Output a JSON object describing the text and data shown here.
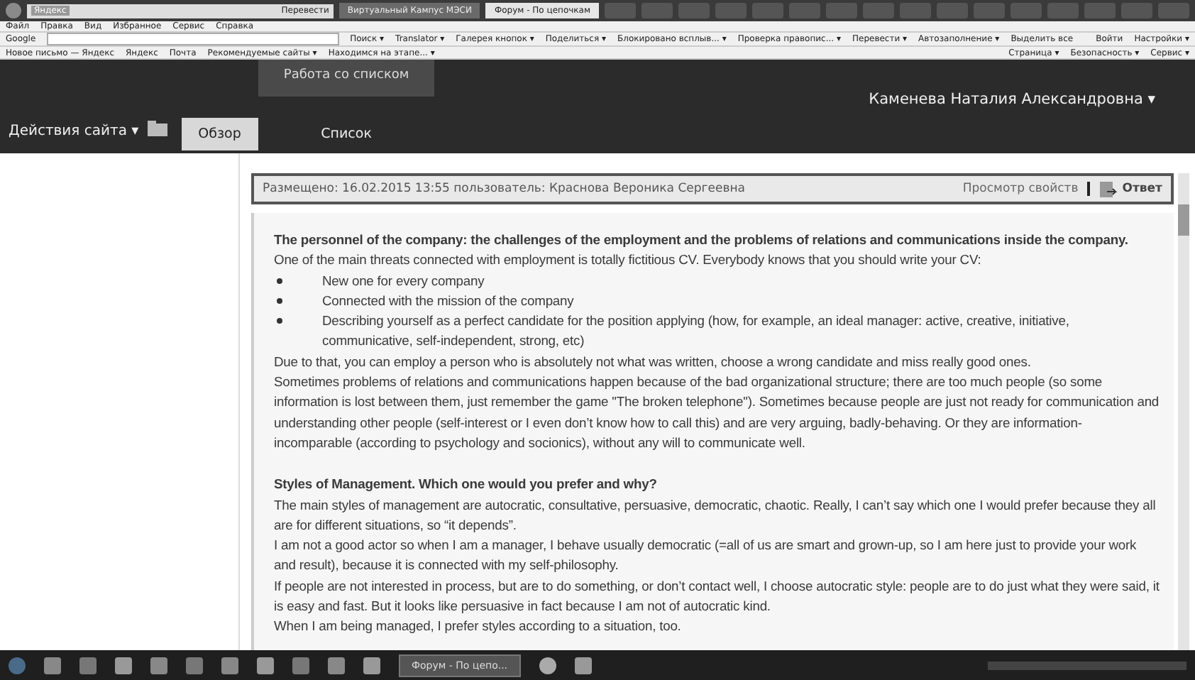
{
  "browser": {
    "tabs": [
      {
        "label": "Виртуальный Кампус МЭСИ",
        "selected": false
      },
      {
        "label": "Форум - По цепочкам",
        "selected": true
      }
    ],
    "address": {
      "site": "Яндекс",
      "translate_button": "Перевести"
    },
    "menu": [
      "Файл",
      "Правка",
      "Вид",
      "Избранное",
      "Сервис",
      "Справка"
    ],
    "toolbar": {
      "search_label": "Google",
      "buttons": [
        "Поиск ▾",
        "Translator ▾",
        "Галерея кнопок ▾",
        "Поделиться ▾",
        "Блокировано всплыв... ▾",
        "Проверка правопис... ▾",
        "Перевести ▾",
        "Автозаполнение ▾",
        "Выделить все"
      ],
      "right": [
        "Войти",
        "Настройки ▾"
      ]
    },
    "favorites": [
      "Новое письмо — Яндекс",
      "Яндекс",
      "Почта",
      "Рекомендуемые сайты ▾",
      "Находимся на этапе... ▾"
    ],
    "command_bar": [
      "Страница ▾",
      "Безопасность ▾",
      "Сервис ▾"
    ]
  },
  "ribbon": {
    "site_actions": "Действия сайта ▾",
    "tab_group": "Работа со списком",
    "tabs": [
      {
        "label": "Обзор",
        "selected": true
      },
      {
        "label": "Список",
        "selected": false
      }
    ],
    "user": "Каменева Наталия Александровна ▾"
  },
  "post": {
    "meta": "Размещено: 16.02.2015 13:55 пользователь: Краснова Вероника Сергеевна",
    "properties_link": "Просмотр свойств",
    "reply_button": "Ответ",
    "body": [
      {
        "kind": "heading",
        "text": "The personnel of the company: the challenges of the employment and the problems of relations and communications inside the company."
      },
      {
        "kind": "paragraph",
        "text": "One of the main threats connected with employment is totally fictitious CV. Everybody knows that you should write your CV:"
      },
      {
        "kind": "bullet",
        "text": "New one for every company"
      },
      {
        "kind": "bullet",
        "text": "Connected with the mission of the company"
      },
      {
        "kind": "bullet",
        "text": "Describing yourself as a perfect candidate for the position applying (how, for example, an ideal manager: active, creative, initiative, communicative, self-independent, strong, etc)"
      },
      {
        "kind": "paragraph",
        "text": "Due to that, you can employ a person who is absolutely not what was written, choose a wrong candidate and miss really good ones."
      },
      {
        "kind": "paragraph",
        "text": "Sometimes problems of relations and communications happen because of the bad organizational structure; there are too much people (so some information is lost between them, just remember the game \"The broken telephone\"). Sometimes because people are just not ready for communication and understanding other people (self-interest or I even don’t know how to call this) and are very arguing, badly-behaving. Or they are information-incomparable (according to psychology and socionics), without any will to communicate well."
      },
      {
        "kind": "gap"
      },
      {
        "kind": "heading",
        "text": "Styles of Management. Which one would you prefer and why?"
      },
      {
        "kind": "paragraph",
        "text": "The main styles of management are autocratic, consultative, persuasive, democratic, chaotic. Really, I can’t say which one I would prefer because they all are for different situations, so “it depends”."
      },
      {
        "kind": "paragraph",
        "text": "I am not a good actor so when I am a manager, I behave usually democratic (=all of us are smart and grown-up, so I am here just to provide your work and result), because it is connected with my self-philosophy."
      },
      {
        "kind": "paragraph",
        "text": "If people are not interested in process, but are to do something, or don’t contact well, I choose autocratic style: people are to do just what they were said, it is easy and fast. But it looks like persuasive in fact because I am not of autocratic kind."
      },
      {
        "kind": "paragraph",
        "text": "When I am being managed, I prefer styles according to a situation, too."
      }
    ]
  },
  "taskbar": {
    "active_window": "Форум - По цепо..."
  }
}
